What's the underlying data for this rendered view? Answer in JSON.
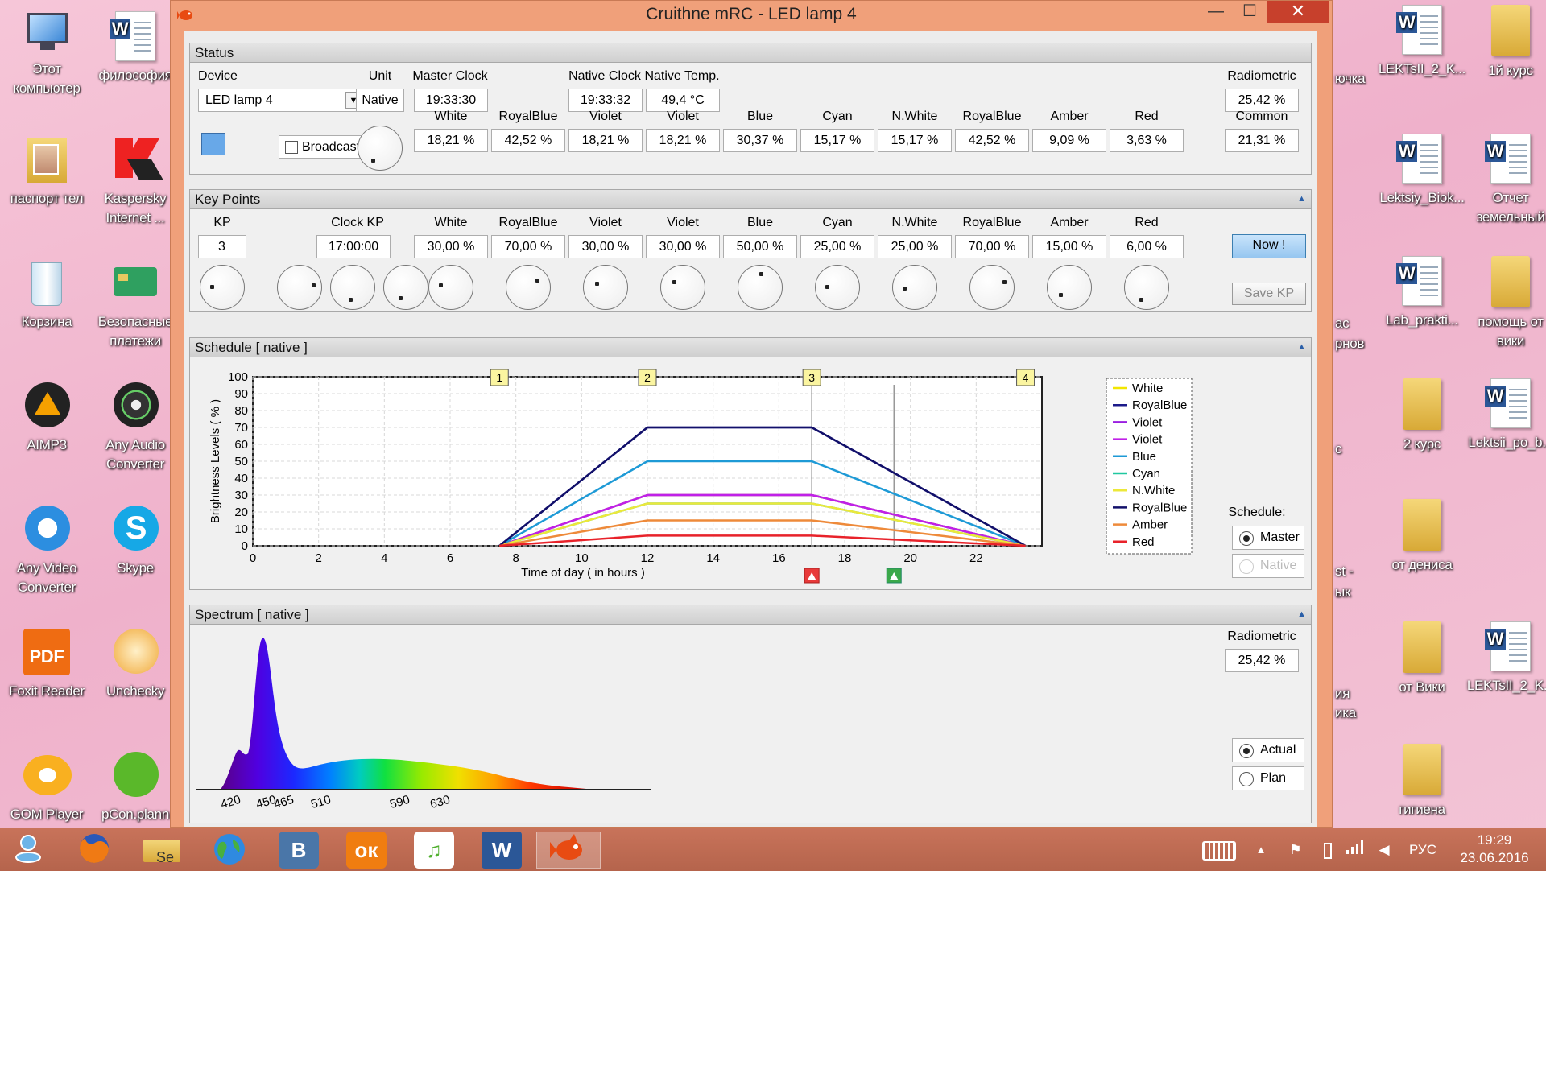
{
  "window": {
    "title": "Cruithne mRC   -   LED lamp 4",
    "min": "—",
    "max": "☐",
    "close": "✕"
  },
  "desktop": {
    "left": [
      {
        "label": "Этот компьютер",
        "type": "pc"
      },
      {
        "label": "философия",
        "type": "word"
      },
      {
        "label": "паспорт тел",
        "type": "photo"
      },
      {
        "label": "Kaspersky Internet ...",
        "type": "kaspersky"
      },
      {
        "label": "Корзина",
        "type": "bin"
      },
      {
        "label": "Безопасные платежи",
        "type": "card"
      },
      {
        "label": "AIMP3",
        "type": "aimp"
      },
      {
        "label": "Any Audio Converter",
        "type": "disc"
      },
      {
        "label": "Any Video Converter",
        "type": "refresh"
      },
      {
        "label": "Skype",
        "type": "skype"
      },
      {
        "label": "Foxit Reader",
        "type": "pdf"
      },
      {
        "label": "Unchecky",
        "type": "leaf"
      },
      {
        "label": "GOM Player",
        "type": "gom"
      },
      {
        "label": "pCon.plann",
        "type": "pcon"
      }
    ],
    "right": [
      {
        "label": "LEKTsII_2_K...",
        "type": "doc"
      },
      {
        "label": "1й курс",
        "type": "folder"
      },
      {
        "label": "Lektsiy_Biok...",
        "type": "word"
      },
      {
        "label": "Отчет земельный",
        "type": "word"
      },
      {
        "label": "Lab_prakti...",
        "type": "word"
      },
      {
        "label": "помощь от вики",
        "type": "folder"
      },
      {
        "label": "2 курс",
        "type": "folder"
      },
      {
        "label": "Lektsii_po_b...",
        "type": "word"
      },
      {
        "label": "от дениса",
        "type": "folder"
      },
      {
        "label": "от Вики",
        "type": "folder"
      },
      {
        "label": "LEKTsII_2_K...",
        "type": "word"
      },
      {
        "label": "гигиена",
        "type": "folder"
      }
    ],
    "partial": [
      "ючка",
      "ас",
      "рнов",
      "с",
      "st -",
      "ык",
      "ия",
      "ика"
    ]
  },
  "status": {
    "header": "Status",
    "device_label": "Device",
    "device_value": "LED lamp 4",
    "unit_label": "Unit",
    "unit_value": "Native",
    "master_clock_label": "Master Clock",
    "master_clock": "19:33:30",
    "native_clock_label": "Native  Clock",
    "native_clock": "19:33:32",
    "native_temp_label": "Native  Temp.",
    "native_temp": "49,4 °C",
    "radiometric_label": "Radiometric",
    "radiometric": "25,42 %",
    "broadcast_label": "Broadcast",
    "channels": [
      {
        "name": "White",
        "value": "18,21 %"
      },
      {
        "name": "RoyalBlue",
        "value": "42,52 %"
      },
      {
        "name": "Violet",
        "value": "18,21 %"
      },
      {
        "name": "Violet",
        "value": "18,21 %"
      },
      {
        "name": "Blue",
        "value": "30,37 %"
      },
      {
        "name": "Cyan",
        "value": "15,17 %"
      },
      {
        "name": "N.White",
        "value": "15,17 %"
      },
      {
        "name": "RoyalBlue",
        "value": "42,52 %"
      },
      {
        "name": "Amber",
        "value": "9,09 %"
      },
      {
        "name": "Red",
        "value": "3,63 %"
      }
    ],
    "common_label": "Common",
    "common_value": "21,31 %"
  },
  "keypoints": {
    "header": "Key Points",
    "kp_label": "KP",
    "kp_value": "3",
    "clock_label": "Clock   KP",
    "clock_value": "17:00:00",
    "channels": [
      {
        "name": "White",
        "value": "30,00 %"
      },
      {
        "name": "RoyalBlue",
        "value": "70,00 %"
      },
      {
        "name": "Violet",
        "value": "30,00 %"
      },
      {
        "name": "Violet",
        "value": "30,00 %"
      },
      {
        "name": "Blue",
        "value": "50,00 %"
      },
      {
        "name": "Cyan",
        "value": "25,00 %"
      },
      {
        "name": "N.White",
        "value": "25,00 %"
      },
      {
        "name": "RoyalBlue",
        "value": "70,00 %"
      },
      {
        "name": "Amber",
        "value": "15,00 %"
      },
      {
        "name": "Red",
        "value": "6,00 %"
      }
    ],
    "now_button": "Now !",
    "save_button": "Save  KP"
  },
  "schedule": {
    "header": "Schedule   [ native ]",
    "schedule_label": "Schedule:",
    "master_option": "Master",
    "native_option": "Native"
  },
  "spectrum": {
    "header": "Spectrum   [ native ]",
    "radiometric_label": "Radiometric",
    "radiometric": "25,42 %",
    "actual_option": "Actual",
    "plan_option": "Plan",
    "ticks": [
      "420",
      "450",
      "465",
      "510",
      "590",
      "630"
    ]
  },
  "chart_data": {
    "type": "line",
    "ylabel": "Brightness Levels  ( % )",
    "xlabel": "Time of day   ( in hours )",
    "xlim": [
      0,
      24
    ],
    "ylim": [
      0,
      100
    ],
    "xticks": [
      0,
      2,
      4,
      6,
      8,
      10,
      12,
      14,
      16,
      18,
      20,
      22
    ],
    "yticks": [
      0,
      10,
      20,
      30,
      40,
      50,
      60,
      70,
      80,
      90,
      100
    ],
    "keypoints": [
      {
        "label": "1",
        "x": 7.5
      },
      {
        "label": "2",
        "x": 12
      },
      {
        "label": "3",
        "x": 17
      },
      {
        "label": "4",
        "x": 23.5
      }
    ],
    "current_time": 19.5,
    "x": [
      7.5,
      12,
      17,
      23.5
    ],
    "series": [
      {
        "name": "White",
        "color": "#f2e600",
        "values": [
          0,
          30,
          30,
          0
        ]
      },
      {
        "name": "RoyalBlue",
        "color": "#1c1a8a",
        "values": [
          0,
          70,
          70,
          0
        ]
      },
      {
        "name": "Violet",
        "color": "#9a1ee0",
        "values": [
          0,
          30,
          30,
          0
        ]
      },
      {
        "name": "Violet",
        "color": "#c020e8",
        "values": [
          0,
          30,
          30,
          0
        ]
      },
      {
        "name": "Blue",
        "color": "#1e9ad6",
        "values": [
          0,
          50,
          50,
          0
        ]
      },
      {
        "name": "Cyan",
        "color": "#20c8a0",
        "values": [
          0,
          25,
          25,
          0
        ]
      },
      {
        "name": "N.White",
        "color": "#ece83a",
        "values": [
          0,
          25,
          25,
          0
        ]
      },
      {
        "name": "RoyalBlue",
        "color": "#12106a",
        "values": [
          0,
          70,
          70,
          0
        ]
      },
      {
        "name": "Amber",
        "color": "#ee8a3a",
        "values": [
          0,
          15,
          15,
          0
        ]
      },
      {
        "name": "Red",
        "color": "#e8222a",
        "values": [
          0,
          6,
          6,
          0
        ]
      }
    ],
    "grid": true,
    "legend": "right"
  },
  "taskbar": {
    "search_hint": "Se",
    "lang": "РУС",
    "time": "19:29",
    "date": "23.06.2016"
  }
}
